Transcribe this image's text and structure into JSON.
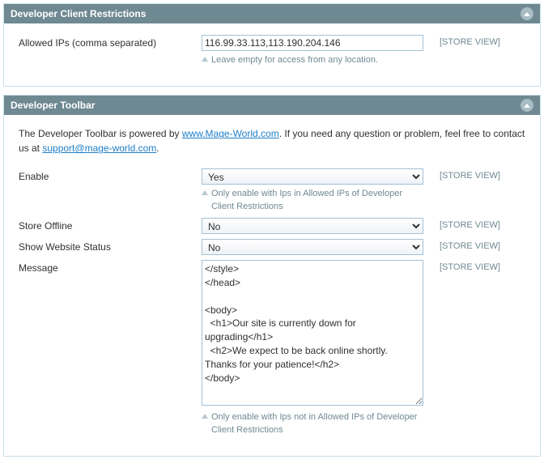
{
  "section1": {
    "title": "Developer Client Restrictions",
    "allowed_ips": {
      "label": "Allowed IPs (comma separated)",
      "value": "116.99.33.113,113.190.204.146",
      "note": "Leave empty for access from any location.",
      "scope": "[STORE VIEW]"
    }
  },
  "section2": {
    "title": "Developer Toolbar",
    "intro_before": "The Developer Toolbar is powered by ",
    "intro_link1_text": "www.Mage-World.com",
    "intro_link1_href": "http://www.Mage-World.com",
    "intro_mid": ". If you need any question or problem, feel free to contact us at ",
    "intro_link2_text": "support@mage-world.com",
    "intro_link2_href": "mailto:support@mage-world.com",
    "intro_after": ".",
    "enable": {
      "label": "Enable",
      "value": "Yes",
      "note": "Only enable with Ips in Allowed IPs of Developer Client Restrictions",
      "scope": "[STORE VIEW]"
    },
    "store_offline": {
      "label": "Store Offline",
      "value": "No",
      "scope": "[STORE VIEW]"
    },
    "show_status": {
      "label": "Show Website Status",
      "value": "No",
      "scope": "[STORE VIEW]"
    },
    "message": {
      "label": "Message",
      "value": "</style>\n</head>\n\n<body>\n  <h1>Our site is currently down for upgrading</h1>\n  <h2>We expect to be back online shortly. Thanks for your patience!</h2>\n</body>",
      "note": "Only enable with Ips not in Allowed IPs of Developer Client Restrictions",
      "scope": "[STORE VIEW]"
    }
  }
}
